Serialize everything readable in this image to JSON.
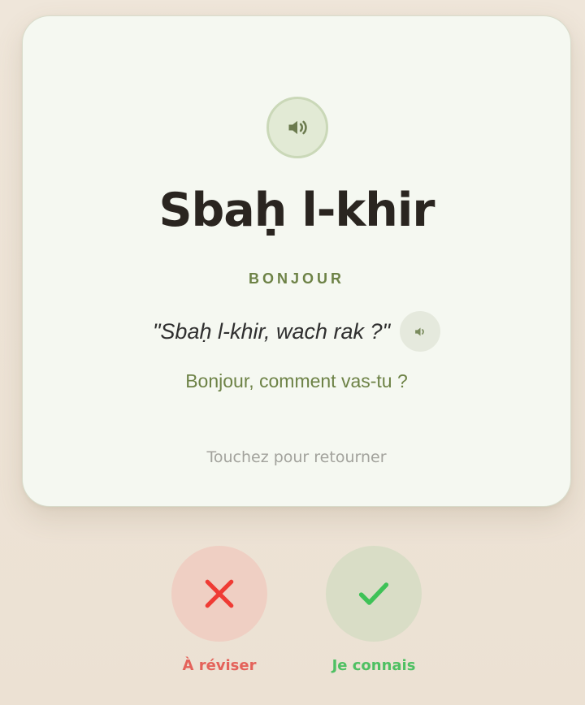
{
  "card": {
    "word": "Sbaḥ l-khir",
    "translation": "BONJOUR",
    "example": "\"Sbaḥ l-khir, wach rak ?\"",
    "example_translation": "Bonjour, comment vas-tu ?",
    "hint": "Touchez pour retourner",
    "audio_icon": "speaker-icon",
    "example_audio_icon": "speaker-icon"
  },
  "actions": {
    "review": {
      "label": "À réviser",
      "icon": "close-icon",
      "color": "#e4625a"
    },
    "know": {
      "label": "Je connais",
      "icon": "check-icon",
      "color": "#4fc063"
    }
  },
  "colors": {
    "background": "#efe6da",
    "card_background": "#f5f8f1",
    "accent_green": "#6d8246",
    "review_red": "#ef3b34",
    "know_green": "#3ec257"
  }
}
